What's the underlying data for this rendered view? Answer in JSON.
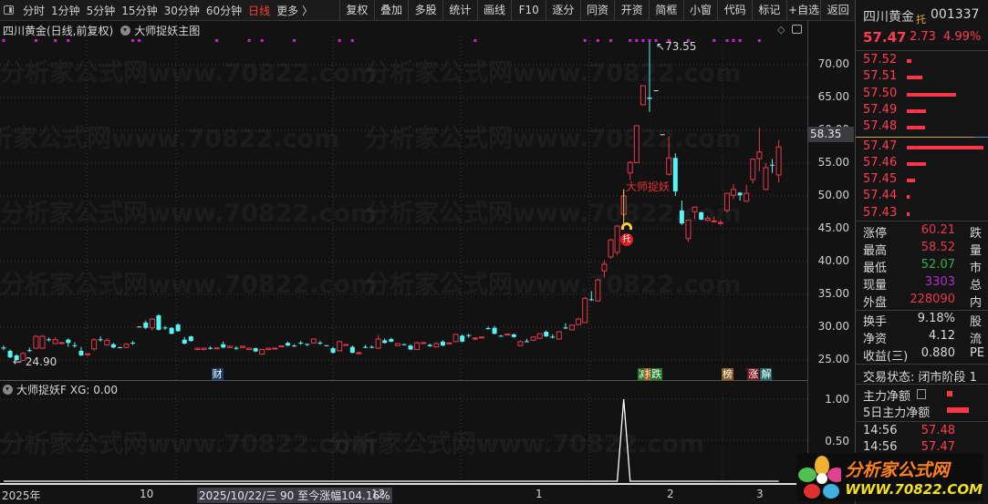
{
  "toolbar": {
    "left_items": [
      "分时",
      "1分钟",
      "5分钟",
      "15分钟",
      "30分钟",
      "60分钟",
      "日线",
      "更多 〉"
    ],
    "active": "日线",
    "buttons": [
      "复权",
      "叠加",
      "多股",
      "统计",
      "画线",
      "F10",
      "逐分",
      "同资",
      "开资",
      "简框",
      "小窗",
      "代码",
      "标记",
      "+自选",
      "返回"
    ]
  },
  "chart": {
    "title": "四川黄金(日线,前复权)",
    "indicator": "大师捉妖主图",
    "signal_label": "大师捉妖",
    "signal_badge": "托",
    "high_label": "73.55",
    "low_label": "24.90",
    "current_price_tag": "58.35",
    "price_ticks": [
      "70.00",
      "65.00",
      "60.00",
      "55.00",
      "50.00",
      "45.00",
      "40.00",
      "35.00",
      "30.00",
      "25.00"
    ],
    "markers": [
      {
        "text": "财",
        "color": "#1d3d66"
      },
      {
        "text": "减",
        "color": "#1f7a2a"
      },
      {
        "text": "持",
        "color": "#b0621e"
      },
      {
        "text": "跌",
        "color": "#1f7a2a"
      },
      {
        "text": "榜",
        "color": "#8a5a1e"
      },
      {
        "text": "涨",
        "color": "#7a1620"
      },
      {
        "text": "解",
        "color": "#1a6a6a"
      }
    ],
    "watermark": "分析家公式网www.70822.com",
    "colors": {
      "up": "#e8384c",
      "down": "#56f5f5",
      "flat": "#e0e0e0",
      "dot": "#d020d0",
      "signal": "#e83030"
    }
  },
  "sub_chart": {
    "title": "大师捉妖F",
    "value_label": "XG: 0.00",
    "ticks": [
      "1.00",
      "0.50"
    ]
  },
  "date_axis": {
    "labels": [
      "2025年",
      "10",
      "12",
      "1",
      "2",
      "3"
    ],
    "hover": "2025/10/22/三 90 至今涨幅104.16%"
  },
  "quote": {
    "name": "四川黄金",
    "tag": "托",
    "code": "001337",
    "price": "57.47",
    "change": "2.73",
    "change_pct": "4.99%",
    "order_book": [
      {
        "price": "57.52",
        "vol_rel": 0.06
      },
      {
        "price": "57.51",
        "vol_rel": 0.2
      },
      {
        "price": "57.50",
        "vol_rel": 0.64
      },
      {
        "price": "57.49",
        "vol_rel": 0.25
      },
      {
        "price": "57.48",
        "vol_rel": 0.24
      },
      {
        "price": "57.47",
        "vol_rel": 1.0
      },
      {
        "price": "57.46",
        "vol_rel": 0.25
      },
      {
        "price": "57.45",
        "vol_rel": 0.11
      },
      {
        "price": "57.44",
        "vol_rel": 0.04
      },
      {
        "price": "57.43",
        "vol_rel": 0.04
      }
    ],
    "stats": [
      {
        "label": "涨停",
        "value": "60.21",
        "color": "#e8384c",
        "right": "跌"
      },
      {
        "label": "最高",
        "value": "58.52",
        "color": "#e8384c",
        "right": "量"
      },
      {
        "label": "最低",
        "value": "52.07",
        "color": "#2fb34a",
        "right": "市"
      },
      {
        "label": "现量",
        "value": "3303",
        "color": "#b030c8",
        "right": "总"
      },
      {
        "label": "外盘",
        "value": "228090",
        "color": "#e8384c",
        "right": "内"
      }
    ],
    "stats2": [
      {
        "label": "换手",
        "value": "9.18%",
        "right": "股"
      },
      {
        "label": "净资",
        "value": "4.12",
        "right": "流"
      },
      {
        "label": "收益(三)",
        "value": "0.880",
        "right": "PE"
      }
    ],
    "trade_status": "交易状态: 闭市阶段 1",
    "flows": [
      {
        "label": "主力净额",
        "bar_rel": 0.25
      },
      {
        "label": "5日主力净额",
        "bar_rel": 1.0
      }
    ],
    "ticks": [
      {
        "time": "14:56",
        "price": "57.48"
      },
      {
        "time": "14:56",
        "price": "57.47"
      }
    ]
  },
  "logo": {
    "title": "分析家公式网",
    "url": "WWW.70822.COM"
  },
  "chart_data": {
    "type": "candlestick",
    "price_range": [
      22.5,
      75
    ],
    "ohlc": [
      [
        26.9,
        27.2,
        26.5,
        26.8
      ],
      [
        26.4,
        26.6,
        25.3,
        25.4
      ],
      [
        25.7,
        25.9,
        24.9,
        25.0
      ],
      [
        24.95,
        26.2,
        24.9,
        26.0
      ],
      [
        26.5,
        26.9,
        26.2,
        26.45
      ],
      [
        26.8,
        28.8,
        26.7,
        28.6
      ],
      [
        26.8,
        28.8,
        26.7,
        28.6
      ],
      [
        28.15,
        28.4,
        27.8,
        28.05
      ],
      [
        27.5,
        28.5,
        27.4,
        28.1
      ],
      [
        27.55,
        27.8,
        27.4,
        27.65
      ],
      [
        28.1,
        28.3,
        27.0,
        27.6
      ],
      [
        27.25,
        27.7,
        26.9,
        27.2
      ],
      [
        26.4,
        27.0,
        25.6,
        25.7
      ],
      [
        25.85,
        26.0,
        25.6,
        25.95
      ],
      [
        26.7,
        28.3,
        26.4,
        28.1
      ],
      [
        28.15,
        28.6,
        27.8,
        28.05
      ],
      [
        27.3,
        28.3,
        27.2,
        28.0
      ],
      [
        27.4,
        27.6,
        26.8,
        26.9
      ],
      [
        26.95,
        27.0,
        26.8,
        26.9
      ],
      [
        26.9,
        27.6,
        26.8,
        27.4
      ],
      [
        27.65,
        27.9,
        27.3,
        27.6
      ],
      [
        30.1,
        30.1,
        30.1,
        30.1
      ],
      [
        30.7,
        31.0,
        29.7,
        29.9
      ],
      [
        29.9,
        31.4,
        29.5,
        31.25
      ],
      [
        31.8,
        32.0,
        29.5,
        29.6
      ],
      [
        29.95,
        30.2,
        29.6,
        29.9
      ],
      [
        29.9,
        30.0,
        28.9,
        29.0
      ],
      [
        30.4,
        30.6,
        29.3,
        29.4
      ],
      [
        28.1,
        28.5,
        27.4,
        27.5
      ],
      [
        28.6,
        28.7,
        27.8,
        27.9
      ],
      [
        26.6,
        26.9,
        26.5,
        26.8
      ],
      [
        26.6,
        26.9,
        26.5,
        26.8
      ],
      [
        26.85,
        27.1,
        26.6,
        26.8
      ],
      [
        26.8,
        26.9,
        26.7,
        26.85
      ],
      [
        27.4,
        27.8,
        26.8,
        26.9
      ],
      [
        26.9,
        27.2,
        26.8,
        27.1
      ],
      [
        26.85,
        27.1,
        26.5,
        26.8
      ],
      [
        26.9,
        27.2,
        26.8,
        27.1
      ],
      [
        26.6,
        26.9,
        26.5,
        26.8
      ],
      [
        26.8,
        26.9,
        26.2,
        26.3
      ],
      [
        25.9,
        26.7,
        25.8,
        26.6
      ],
      [
        26.6,
        26.9,
        26.5,
        26.8
      ],
      [
        26.75,
        26.9,
        26.7,
        26.8
      ],
      [
        27.1,
        27.2,
        27.0,
        27.15
      ],
      [
        27.6,
        27.8,
        27.1,
        27.2
      ],
      [
        27.2,
        27.4,
        27.0,
        27.15
      ],
      [
        27.65,
        27.9,
        27.3,
        27.6
      ],
      [
        27.45,
        27.5,
        27.1,
        27.4
      ],
      [
        27.6,
        28.3,
        27.5,
        28.2
      ],
      [
        27.65,
        27.9,
        27.3,
        27.6
      ],
      [
        27.25,
        27.3,
        27.1,
        27.2
      ],
      [
        26.8,
        27.0,
        26.0,
        26.1
      ],
      [
        26.4,
        27.9,
        26.3,
        27.8
      ],
      [
        27.3,
        27.4,
        27.2,
        27.35
      ],
      [
        27.0,
        27.2,
        26.0,
        26.1
      ],
      [
        26.05,
        26.3,
        25.9,
        26.1
      ],
      [
        27.0,
        27.3,
        26.8,
        26.95
      ],
      [
        27.0,
        27.2,
        26.8,
        26.95
      ],
      [
        26.8,
        28.8,
        26.7,
        28.2
      ],
      [
        28.0,
        28.3,
        27.5,
        27.6
      ],
      [
        28.2,
        28.4,
        27.7,
        27.8
      ],
      [
        27.2,
        27.6,
        27.1,
        27.5
      ],
      [
        27.4,
        27.5,
        27.3,
        27.35
      ],
      [
        27.2,
        27.4,
        26.5,
        26.6
      ],
      [
        26.6,
        27.8,
        26.5,
        27.6
      ],
      [
        27.6,
        27.7,
        27.5,
        27.65
      ],
      [
        27.3,
        27.5,
        27.0,
        27.1
      ],
      [
        27.0,
        27.7,
        26.9,
        27.5
      ],
      [
        27.8,
        28.0,
        27.1,
        27.2
      ],
      [
        27.5,
        27.6,
        27.4,
        27.6
      ],
      [
        27.8,
        29.0,
        27.7,
        28.9
      ],
      [
        28.7,
        28.9,
        27.7,
        27.8
      ],
      [
        28.8,
        29.0,
        28.4,
        28.7
      ],
      [
        28.3,
        28.5,
        28.0,
        28.35
      ],
      [
        28.4,
        28.5,
        28.3,
        28.5
      ],
      [
        29.85,
        30.1,
        29.6,
        29.8
      ],
      [
        29.9,
        30.2,
        28.9,
        29.0
      ],
      [
        28.7,
        28.8,
        28.6,
        28.65
      ],
      [
        28.9,
        29.0,
        28.8,
        28.95
      ],
      [
        28.9,
        29.0,
        28.4,
        28.5
      ],
      [
        27.2,
        28.0,
        27.1,
        27.8
      ],
      [
        27.85,
        28.2,
        27.7,
        27.8
      ],
      [
        28.0,
        28.6,
        27.9,
        28.5
      ],
      [
        28.3,
        29.1,
        28.2,
        29.0
      ],
      [
        29.3,
        29.5,
        28.5,
        28.6
      ],
      [
        28.55,
        28.9,
        28.3,
        28.5
      ],
      [
        28.2,
        29.4,
        28.1,
        29.3
      ],
      [
        29.95,
        30.6,
        29.7,
        29.9
      ],
      [
        29.6,
        30.4,
        29.5,
        30.3
      ],
      [
        30.4,
        31.4,
        30.3,
        31.25
      ],
      [
        30.7,
        34.6,
        30.6,
        34.4
      ],
      [
        34.25,
        35.5,
        34.0,
        34.2
      ],
      [
        34.0,
        37.4,
        33.9,
        37.2
      ],
      [
        38.6,
        40.2,
        37.6,
        39.6
      ],
      [
        40.7,
        43.5,
        40.4,
        43.3
      ],
      [
        41.4,
        45.6,
        41.0,
        45.4
      ],
      [
        47.2,
        51.0,
        46.9,
        50.0
      ],
      [
        53.5,
        55.3,
        52.4,
        55.1
      ],
      [
        55.1,
        60.8,
        55.0,
        60.7
      ],
      [
        63.9,
        66.8,
        63.8,
        66.8
      ],
      [
        65.0,
        73.55,
        62.8,
        64.8
      ],
      [
        66.1,
        66.1,
        66.1,
        66.1
      ],
      [
        59.4,
        59.4,
        59.4,
        59.4
      ],
      [
        53.3,
        59.0,
        53.1,
        55.8
      ],
      [
        55.8,
        56.5,
        50.0,
        50.7
      ],
      [
        47.8,
        49.3,
        45.6,
        45.8
      ],
      [
        43.5,
        46.4,
        43.0,
        46.3
      ],
      [
        47.6,
        48.4,
        46.5,
        48.3
      ],
      [
        47.5,
        47.6,
        46.3,
        46.4
      ],
      [
        46.3,
        47.0,
        46.2,
        46.6
      ],
      [
        46.1,
        46.9,
        46.0,
        46.2
      ],
      [
        45.85,
        46.3,
        45.5,
        45.95
      ],
      [
        47.8,
        50.5,
        47.5,
        50.4
      ],
      [
        50.1,
        51.8,
        49.5,
        51.0
      ],
      [
        50.5,
        50.6,
        49.3,
        50.1
      ],
      [
        49.2,
        51.7,
        49.1,
        50.4
      ],
      [
        52.5,
        55.7,
        51.9,
        55.6
      ],
      [
        55.7,
        60.4,
        53.8,
        56.7
      ],
      [
        51.0,
        55.0,
        50.9,
        54.3
      ],
      [
        54.75,
        55.6,
        53.5,
        54.7
      ],
      [
        53.2,
        58.52,
        52.07,
        57.47
      ]
    ],
    "top_dot_indices": [
      0,
      5,
      8,
      10,
      20,
      21,
      33,
      38,
      40,
      45,
      52,
      54,
      73,
      90,
      92,
      94,
      97,
      98,
      99,
      100,
      101,
      103,
      106,
      110,
      112,
      113,
      114,
      117
    ],
    "signal_index": 96,
    "marker_indices": [
      33,
      99,
      100,
      101,
      112,
      116,
      118
    ],
    "xg": {
      "peak_index": 96,
      "peak_value": 1,
      "base_value": 0
    }
  }
}
